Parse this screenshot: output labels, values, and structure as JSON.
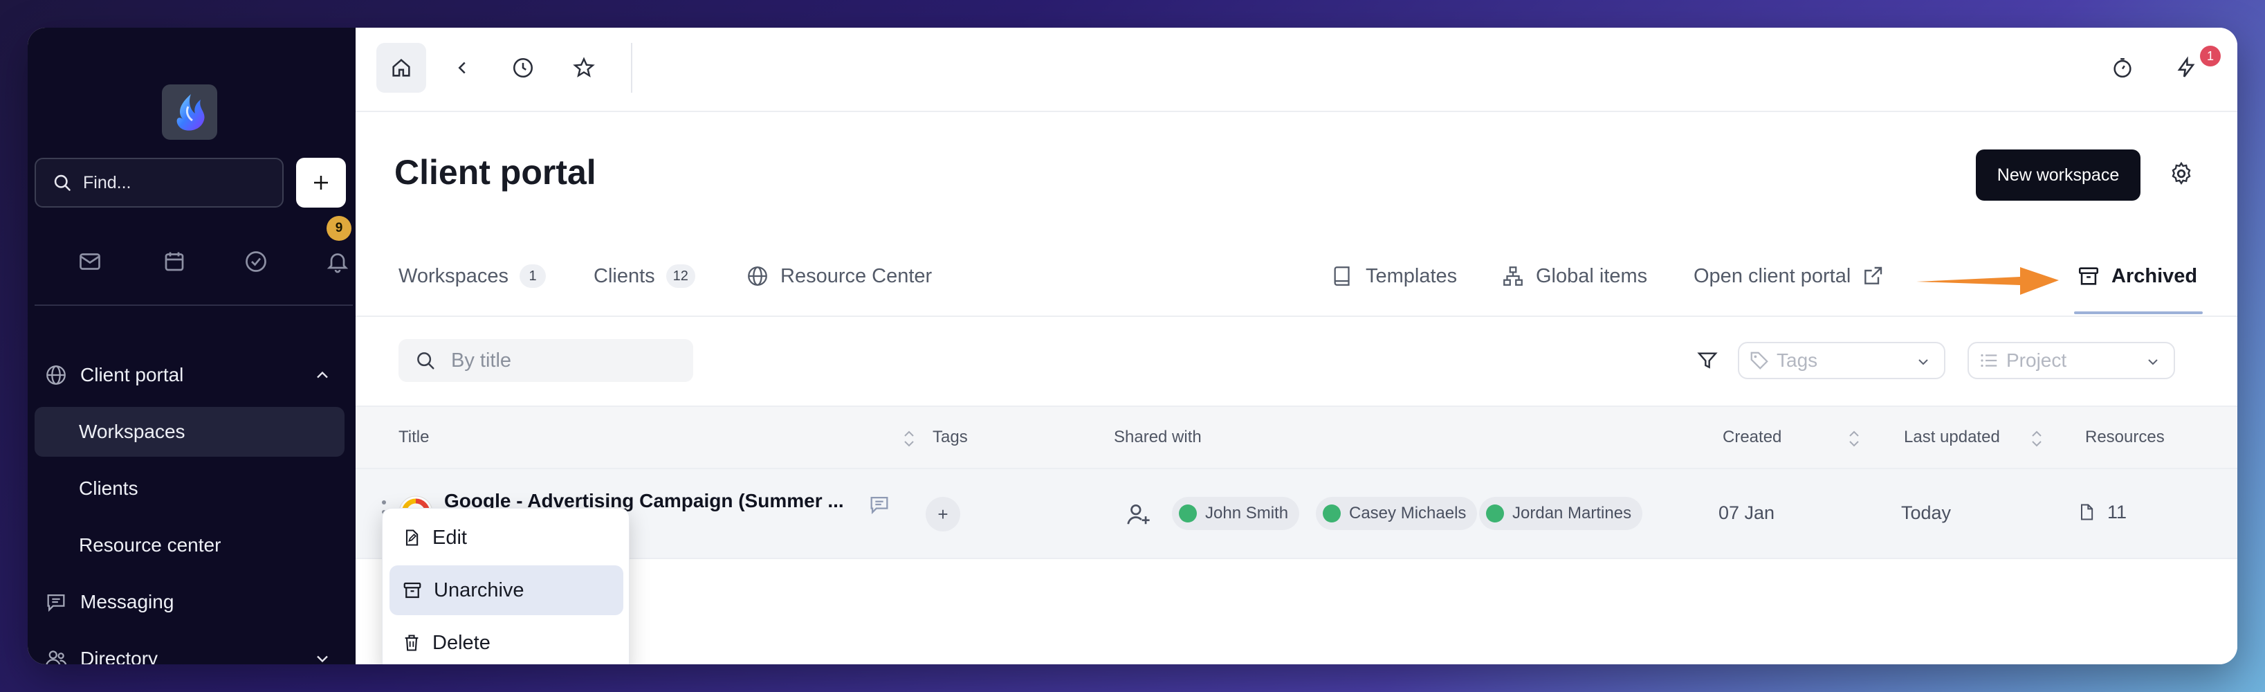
{
  "sidebar": {
    "search_placeholder": "Find...",
    "notification_count": "9",
    "nav": {
      "client_portal": "Client portal",
      "workspaces": "Workspaces",
      "clients": "Clients",
      "resource_center": "Resource center",
      "messaging": "Messaging",
      "directory": "Directory"
    }
  },
  "topbar": {
    "bolt_badge": "1"
  },
  "header": {
    "title": "Client portal",
    "new_workspace_label": "New workspace"
  },
  "tabs": {
    "workspaces": {
      "label": "Workspaces",
      "count": "1"
    },
    "clients": {
      "label": "Clients",
      "count": "12"
    },
    "resource_center": {
      "label": "Resource Center"
    },
    "templates": {
      "label": "Templates"
    },
    "global_items": {
      "label": "Global items"
    },
    "open_portal": {
      "label": "Open client portal"
    },
    "archived": {
      "label": "Archived"
    }
  },
  "filters": {
    "title_placeholder": "By title",
    "tags_placeholder": "Tags",
    "project_placeholder": "Project"
  },
  "table": {
    "columns": {
      "title": "Title",
      "tags": "Tags",
      "shared_with": "Shared with",
      "created": "Created",
      "last_updated": "Last updated",
      "resources": "Resources"
    },
    "row": {
      "title": "Google - Advertising Campaign (Summer ...",
      "tag_add": "+",
      "shared": [
        "John Smith",
        "Casey Michaels",
        "Jordan Martines"
      ],
      "created": "07 Jan",
      "last_updated": "Today",
      "resources": "11"
    }
  },
  "context_menu": {
    "edit": "Edit",
    "unarchive": "Unarchive",
    "delete": "Delete"
  },
  "colors": {
    "sidebar_bg": "#0d0b24",
    "accent_arrow": "#f08a2e",
    "badge_yellow": "#e0a93c",
    "badge_red": "#e04a5e",
    "chip_dot": "#3cb371",
    "menu_highlight": "#e3e8f4"
  }
}
